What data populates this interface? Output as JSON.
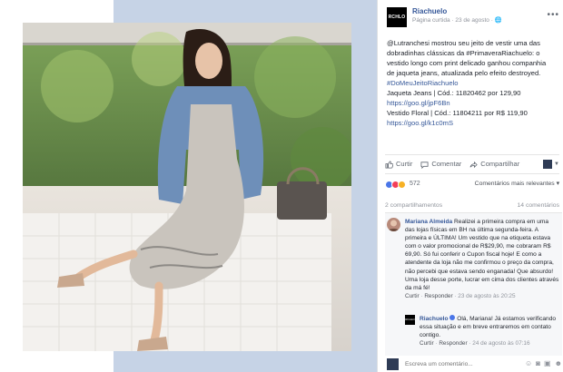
{
  "page": {
    "name": "Riachuelo",
    "logo_text": "RCHLO",
    "meta": "Página curtida · 23 de agosto · 🌐",
    "more": "•••"
  },
  "post": {
    "text_lines": [
      "@Lutranchesi mostrou seu jeito de vestir uma das",
      "dobradinhas clássicas da #PrimaveraRiachuelo: o",
      "vestido longo com print delicado ganhou companhia",
      "de jaqueta jeans, atualizada pelo efeito destroyed.",
      "#DoMeuJeitoRiachuelo",
      "Jaqueta Jeans | Cód.: 11820462 por 129,90",
      "https://goo.gl/jpF6Bn",
      "Vestido Floral | Cód.: 11804211 por R$ 119,90",
      "https://goo.gl/k1c0mS"
    ],
    "hashtag_line": "#DoMeuJeitoRiachuelo",
    "link1": "https://goo.gl/jpF6Bn",
    "link2": "https://goo.gl/k1c0mS"
  },
  "actions": {
    "like": "Curtir",
    "comment": "Comentar",
    "share": "Compartilhar"
  },
  "reactions": {
    "count": "572",
    "sort": "Comentários mais relevantes ▾"
  },
  "stats": {
    "shares": "2 compartilhamentos",
    "comments": "14 comentários"
  },
  "comments": [
    {
      "author": "Mariana Almeida",
      "text": "Realizei a primeira compra em uma das lojas físicas em BH na última segunda-feira. A primeira e ÚLTIMA! Um vestido que na etiqueta estava com o valor promocional de R$29,90, me cobraram R$ 69,90. Só fui conferir o Cupon fiscal hoje! E como a atendente da loja não me confirmou o preço da compra, não percebi que estava sendo enganada! Que absurdo! Uma loja desse porte, lucrar em cima dos clientes através da má fé!",
      "like": "Curtir",
      "reply": "Responder",
      "date": "23 de agosto às 20:25"
    },
    {
      "author": "Riachuelo",
      "text": "Olá, Mariana! Já estamos verificando essa situação e em breve entraremos em contato contigo.",
      "like": "Curtir",
      "reply": "Responder",
      "date": "24 de agosto às 07:16"
    }
  ],
  "composer": {
    "placeholder": "Escreva um comentário..."
  },
  "colors": {
    "link": "#365899",
    "accent_block": "#c6d3e6",
    "like_blue": "#4a76e8"
  }
}
